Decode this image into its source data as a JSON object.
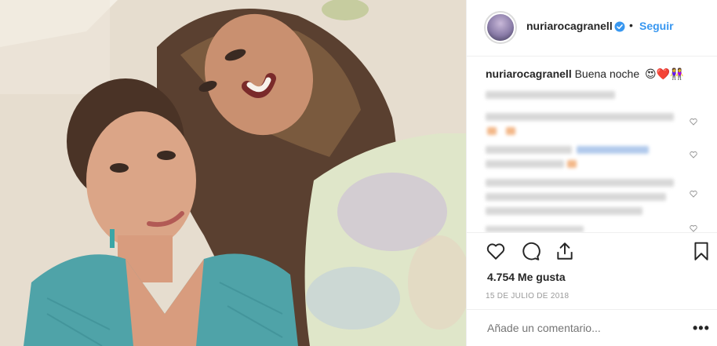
{
  "post": {
    "username": "nuriarocagranell",
    "verified": true,
    "separator": "•",
    "follow_label": "Seguir",
    "caption_user": "nuriarocagranell",
    "caption_text": "Buena noche",
    "caption_emojis": "😍❤️👭",
    "likes_label": "4.754 Me gusta",
    "date_label": "15 DE JULIO DE 2018",
    "add_comment_placeholder": "Añade un comentario...",
    "more_label": "•••"
  },
  "icons": {
    "like": "heart-outline-icon",
    "comment": "speech-bubble-icon",
    "share": "share-upload-icon",
    "save": "bookmark-icon",
    "verified": "verified-badge-icon",
    "comment_like": "small-heart-icon"
  },
  "colors": {
    "link_blue": "#3897f0",
    "text": "#262626",
    "muted": "#999999",
    "border": "#efefef"
  }
}
